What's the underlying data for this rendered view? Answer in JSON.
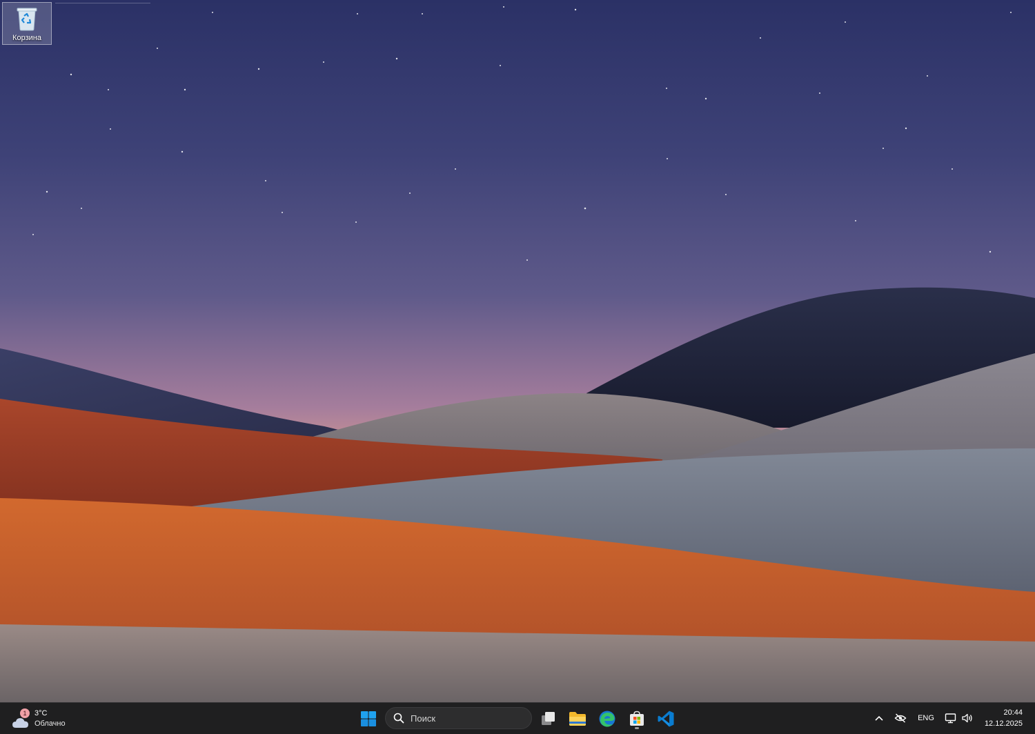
{
  "desktop": {
    "icons": [
      {
        "label": "Корзина",
        "icon": "recycle-bin-icon"
      }
    ]
  },
  "taskbar": {
    "weather": {
      "temperature": "3°C",
      "condition": "Облачно",
      "badge": "1",
      "icon": "cloud-icon"
    },
    "search": {
      "placeholder": "Поиск",
      "icon": "search-icon"
    },
    "apps": [
      {
        "name": "start",
        "icon": "windows-logo-icon"
      },
      {
        "name": "task-view",
        "icon": "task-view-icon"
      },
      {
        "name": "file-explorer",
        "icon": "folder-icon"
      },
      {
        "name": "edge",
        "icon": "edge-icon"
      },
      {
        "name": "store",
        "icon": "store-icon",
        "running": true
      },
      {
        "name": "vscode",
        "icon": "vscode-icon"
      }
    ],
    "tray": {
      "language": "ENG",
      "time": "20:44",
      "date": "12.12.2025"
    }
  },
  "colors": {
    "taskbar_bg": "#1f1f20",
    "accent_blue": "#0a84ff"
  }
}
